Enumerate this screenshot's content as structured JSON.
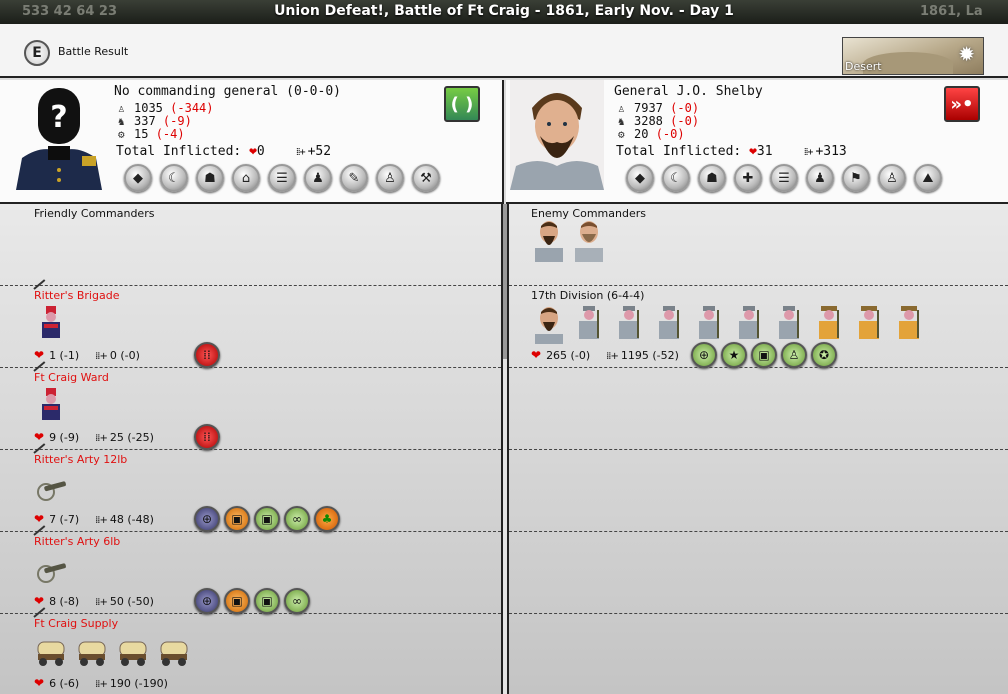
{
  "window": {
    "title": "Union Defeat!, Battle of Ft Craig - 1861, Early Nov. - Day 1",
    "ghost_left": "533     42      64      23",
    "ghost_right": "1861, La"
  },
  "header": {
    "hotkey": "E",
    "label": "Battle Result",
    "terrain": "Desert"
  },
  "friendly": {
    "general_name": "No commanding general (0-0-0)",
    "infantry": "1035",
    "infantry_loss": "(-344)",
    "cavalry": "337",
    "cavalry_loss": "(-9)",
    "artillery": "15",
    "artillery_loss": "(-4)",
    "total_label": "Total Inflicted:",
    "hits": "0",
    "kills": "+52",
    "action_icon": "retreat-cycle-icon"
  },
  "enemy": {
    "general_name": "General J.O. Shelby",
    "infantry": "7937",
    "infantry_loss": "(-0)",
    "cavalry": "3288",
    "cavalry_loss": "(-0)",
    "artillery": "20",
    "artillery_loss": "(-0)",
    "total_label": "Total Inflicted:",
    "hits": "31",
    "kills": "+313",
    "action_icon": "advance-arrows-icon"
  },
  "columns": {
    "friendly_title": "Friendly Commanders",
    "enemy_title": "Enemy Commanders"
  },
  "friendly_units": [
    {
      "name": "Ritter's Brigade",
      "hits": "1 (-1)",
      "kills": "0 (-0)"
    },
    {
      "name": "Ft Craig Ward",
      "hits": "9 (-9)",
      "kills": "25 (-25)"
    },
    {
      "name": "Ritter's Arty 12lb",
      "hits": "7 (-7)",
      "kills": "48 (-48)"
    },
    {
      "name": "Ritter's Arty 6lb",
      "hits": "8 (-8)",
      "kills": "50 (-50)"
    },
    {
      "name": "Ft Craig Supply",
      "hits": "6 (-6)",
      "kills": "190 (-190)"
    }
  ],
  "enemy_units": [
    {
      "name": "17th Division (6-4-4)",
      "hits": "265 (-0)",
      "kills": "1195 (-52)"
    }
  ],
  "colors": {
    "loss": "#dd0000",
    "unit_title": "#e01010"
  }
}
